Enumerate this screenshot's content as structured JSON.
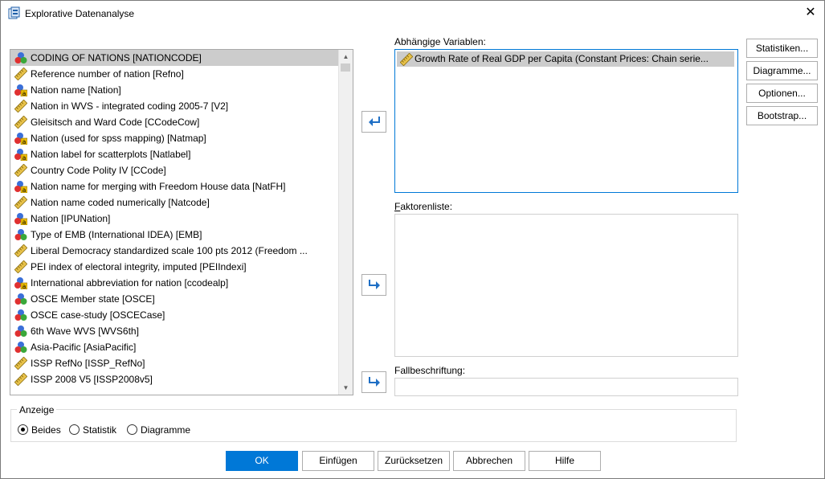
{
  "window": {
    "title": "Explorative Datenanalyse",
    "close_glyph": "✕"
  },
  "variables": [
    {
      "label": "CODING OF NATIONS [NATIONCODE]",
      "type": "nominal",
      "selected": true
    },
    {
      "label": "Reference number of nation [Refno]",
      "type": "scale"
    },
    {
      "label": "Nation name [Nation]",
      "type": "nominal-string"
    },
    {
      "label": "Nation in WVS - integrated coding 2005-7 [V2]",
      "type": "scale"
    },
    {
      "label": "Gleisitsch and Ward Code [CCodeCow]",
      "type": "scale"
    },
    {
      "label": "Nation (used for spss mapping) [Natmap]",
      "type": "nominal-string"
    },
    {
      "label": "Nation label for scatterplots [Natlabel]",
      "type": "nominal-string"
    },
    {
      "label": "Country Code Polity IV [CCode]",
      "type": "scale"
    },
    {
      "label": "Nation name for merging with Freedom House data [NatFH]",
      "type": "nominal-string"
    },
    {
      "label": "Nation name coded numerically [Natcode]",
      "type": "scale"
    },
    {
      "label": "Nation [IPUNation]",
      "type": "nominal-string"
    },
    {
      "label": "Type of EMB (International IDEA) [EMB]",
      "type": "nominal"
    },
    {
      "label": "Liberal Democracy standardized scale 100 pts 2012 (Freedom ...",
      "type": "scale"
    },
    {
      "label": "PEI index of electoral integrity, imputed [PEIIndexi]",
      "type": "scale"
    },
    {
      "label": "International abbreviation for nation [ccodealp]",
      "type": "nominal-string"
    },
    {
      "label": "OSCE Member state [OSCE]",
      "type": "nominal"
    },
    {
      "label": "OSCE case-study [OSCECase]",
      "type": "nominal"
    },
    {
      "label": "6th Wave WVS [WVS6th]",
      "type": "nominal"
    },
    {
      "label": "Asia-Pacific [AsiaPacific]",
      "type": "nominal"
    },
    {
      "label": "ISSP RefNo [ISSP_RefNo]",
      "type": "scale"
    },
    {
      "label": "ISSP 2008 V5 [ISSP2008v5]",
      "type": "scale"
    }
  ],
  "scroll": {
    "up": "▲",
    "down": "▼"
  },
  "dependent": {
    "label": "Abhängige Variablen:",
    "items": [
      "Growth Rate of Real GDP per Capita (Constant Prices: Chain serie..."
    ]
  },
  "factors": {
    "label": "Faktorenliste:",
    "items": []
  },
  "case_label": {
    "label": "Fallbeschriftung:",
    "value": ""
  },
  "side_buttons": {
    "statistics": "Statistiken...",
    "plots": "Diagramme...",
    "options": "Optionen...",
    "bootstrap": "Bootstrap..."
  },
  "display": {
    "legend": "Anzeige",
    "options": [
      "Beides",
      "Statistik",
      "Diagramme"
    ],
    "selected": "Beides"
  },
  "bottom_buttons": {
    "ok": "OK",
    "paste": "Einfügen",
    "reset": "Zurücksetzen",
    "cancel": "Abbrechen",
    "help": "Hilfe"
  },
  "colors": {
    "accent": "#0078d7",
    "selection": "#cccccc",
    "ruler": "#c9a227",
    "ball_red": "#e03030",
    "ball_green": "#3aa83a",
    "ball_blue": "#3a6fd8"
  }
}
